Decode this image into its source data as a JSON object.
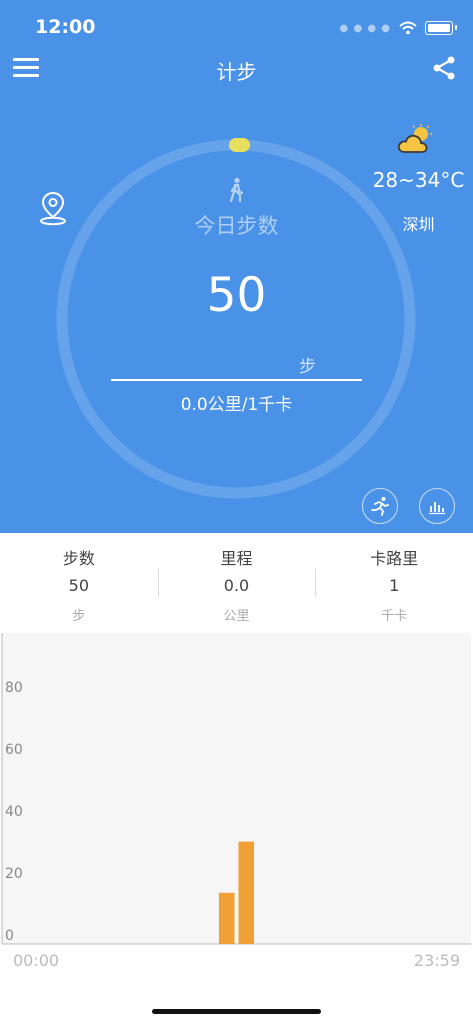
{
  "status_bar": {
    "time": "12:00"
  },
  "nav": {
    "title": "计步",
    "menu_icon": "menu-icon",
    "share_icon": "share-icon"
  },
  "today": {
    "label": "今日步数",
    "steps": "50",
    "unit": "步",
    "distance_calories": "0.0公里/1千卡",
    "ring_progress": 0.0
  },
  "weather": {
    "temperature": "28~34°C",
    "city": "深圳",
    "icon": "partly-cloudy-icon"
  },
  "actions": {
    "run_icon": "running-icon",
    "stats_icon": "bar-chart-icon",
    "location_icon": "location-icon"
  },
  "stats": [
    {
      "label": "步数",
      "value": "50",
      "unit": "步"
    },
    {
      "label": "里程",
      "value": "0.0",
      "unit": "公里"
    },
    {
      "label": "卡路里",
      "value": "1",
      "unit": "千卡"
    }
  ],
  "colors": {
    "primary": "#4a92e8",
    "bar": "#f0a035",
    "ring_marker": "#e7df5e"
  },
  "chart_data": {
    "type": "bar",
    "y_ticks": [
      "0",
      "20",
      "40",
      "60",
      "80"
    ],
    "ylim": [
      0,
      88
    ],
    "x_start_label": "00:00",
    "x_end_label": "23:59",
    "x_range_hours": [
      0,
      24
    ],
    "bars": [
      {
        "hour": 11.0,
        "value": 16.5
      },
      {
        "hour": 12.0,
        "value": 33
      }
    ],
    "grid": false
  }
}
